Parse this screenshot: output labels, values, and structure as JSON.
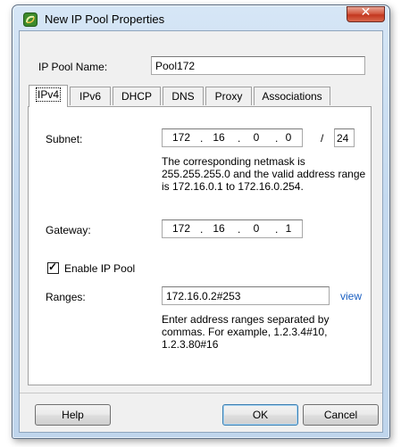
{
  "window": {
    "title": "New IP Pool Properties"
  },
  "pool_name": {
    "label": "IP Pool Name:",
    "value": "Pool172"
  },
  "tabs": [
    {
      "label": "IPv4",
      "active": true
    },
    {
      "label": "IPv6",
      "active": false
    },
    {
      "label": "DHCP",
      "active": false
    },
    {
      "label": "DNS",
      "active": false
    },
    {
      "label": "Proxy",
      "active": false
    },
    {
      "label": "Associations",
      "active": false
    }
  ],
  "subnet": {
    "label": "Subnet:",
    "octets": [
      "172",
      "16",
      "0",
      "0"
    ],
    "slash": "/",
    "prefix": "24",
    "info_lines": [
      "The corresponding netmask is",
      "255.255.255.0 and the valid address range",
      "is 172.16.0.1 to 172.16.0.254."
    ]
  },
  "gateway": {
    "label": "Gateway:",
    "octets": [
      "172",
      "16",
      "0",
      "1"
    ]
  },
  "enable_pool": {
    "label": "Enable IP Pool",
    "checked": true,
    "check_glyph": "✓"
  },
  "ranges": {
    "label": "Ranges:",
    "value": "172.16.0.2#253",
    "link": "view",
    "info_lines": [
      "Enter address ranges separated by",
      "commas. For example, 1.2.3.4#10,",
      "1.2.3.80#16"
    ]
  },
  "buttons": {
    "help": "Help",
    "ok": "OK",
    "cancel": "Cancel"
  },
  "icons": {
    "close": "close-icon",
    "app": "ip-pool-app-icon"
  },
  "colors": {
    "link": "#1a5fc1",
    "close_button": "#c3371f",
    "frame": "#c4d9ef"
  }
}
